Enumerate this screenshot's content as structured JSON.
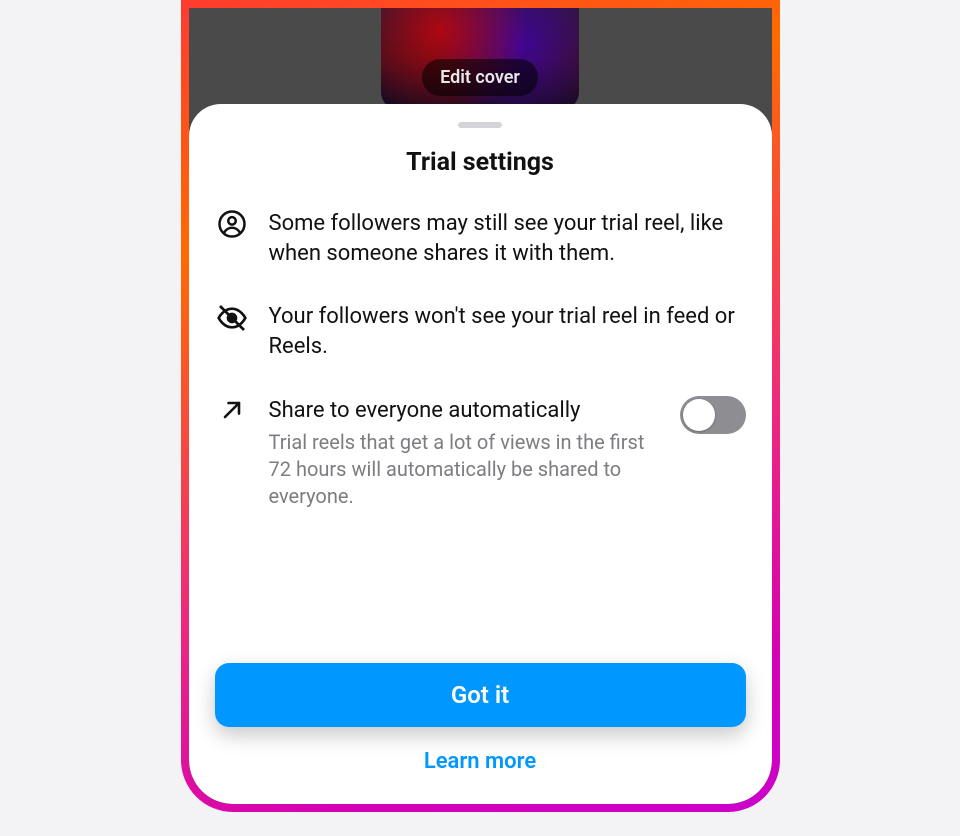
{
  "cover": {
    "edit_label": "Edit cover"
  },
  "sheet": {
    "title": "Trial settings",
    "rows": [
      {
        "text": "Some followers may still see your trial reel, like when someone shares it with them."
      },
      {
        "text": "Your followers won't see your trial reel in feed or Reels."
      },
      {
        "text": "Share to everyone automatically",
        "sub": "Trial reels that get a lot of views in the first 72 hours will automatically be shared to everyone.",
        "toggle_on": false
      }
    ],
    "primary_label": "Got it",
    "link_label": "Learn more"
  }
}
